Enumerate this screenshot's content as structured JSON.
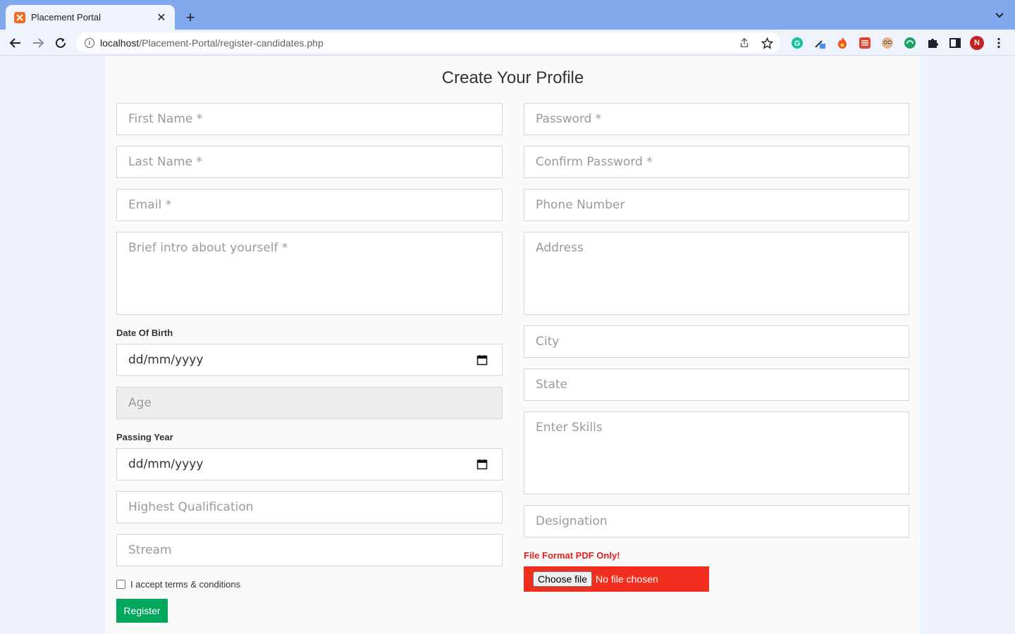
{
  "browser": {
    "tab_title": "Placement Portal",
    "url_host": "localhost",
    "url_path": "/Placement-Portal/register-candidates.php",
    "profile_initial": "N"
  },
  "page": {
    "title": "Create Your Profile"
  },
  "form": {
    "first_name_placeholder": "First Name *",
    "last_name_placeholder": "Last Name *",
    "email_placeholder": "Email *",
    "intro_placeholder": "Brief intro about yourself *",
    "dob_label": "Date Of Birth",
    "dob_value": "dd/mm/yyyy",
    "age_placeholder": "Age",
    "passing_year_label": "Passing Year",
    "passing_year_value": "dd/mm/yyyy",
    "qualification_placeholder": "Highest Qualification",
    "stream_placeholder": "Stream",
    "password_placeholder": "Password *",
    "confirm_password_placeholder": "Confirm Password *",
    "phone_placeholder": "Phone Number",
    "address_placeholder": "Address",
    "city_placeholder": "City",
    "state_placeholder": "State",
    "skills_placeholder": "Enter Skills",
    "designation_placeholder": "Designation",
    "file_format_label": "File Format PDF Only!",
    "choose_file_label": "Choose file",
    "file_status": "No file chosen",
    "terms_label": "I accept terms & conditions",
    "register_label": "Register"
  },
  "colors": {
    "register_button": "#00a65a",
    "file_box": "#f22e1f",
    "file_format_label": "#e31f1f"
  }
}
